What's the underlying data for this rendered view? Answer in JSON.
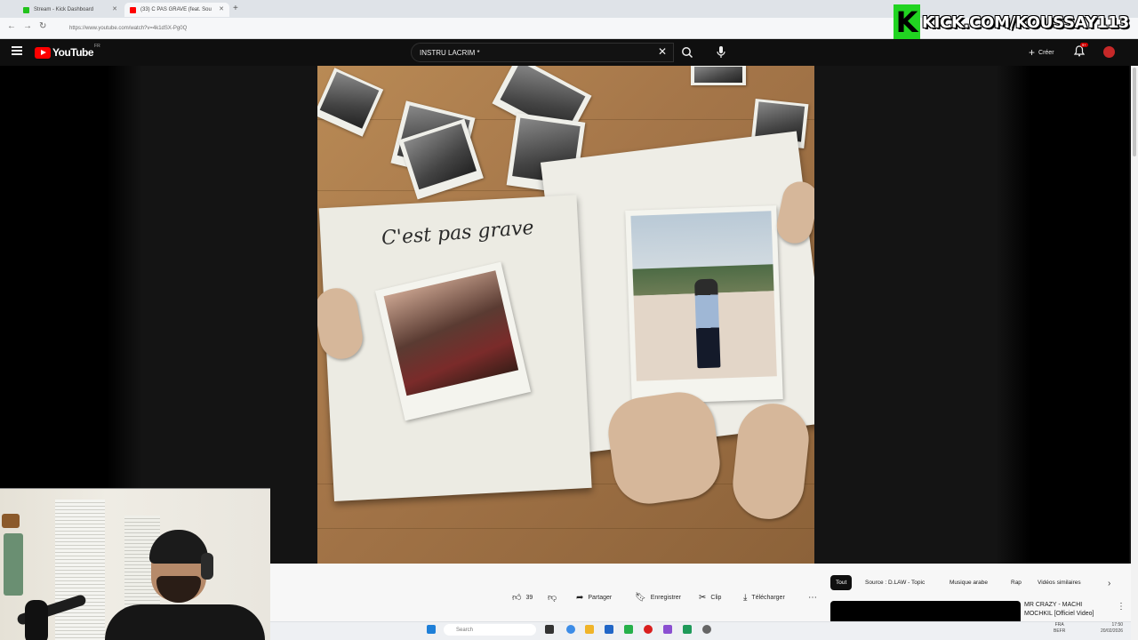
{
  "browser": {
    "tabs": [
      {
        "label": "Stream - Kick Dashboard",
        "favicon_color": "#21c21c"
      },
      {
        "label": "(33) C PAS GRAVE (feat. Sou",
        "favicon_color": "#ff0000"
      }
    ],
    "url": "https://www.youtube.com/watch?v=4k1dSX-Pg0Q"
  },
  "overlay": {
    "kick_logo": "K",
    "kick_text": "KICK.COM/KOUSSAY113",
    "accent": "#21d421"
  },
  "youtube": {
    "logo_word": "YouTube",
    "country_code": "FR",
    "search_value": "INSTRU LACRIM *",
    "create_label": "Créer",
    "notification_badge": "9+",
    "video": {
      "cover_text": "C'est pas grave"
    },
    "actions": {
      "like_count": "39",
      "share": "Partager",
      "save": "Enregistrer",
      "clip": "Clip",
      "download": "Télécharger"
    },
    "chips": [
      "Tout",
      "Source : D.LAW - Topic",
      "Musique arabe",
      "Rap",
      "Vidéos similaires"
    ],
    "next_video_title": "MR CRAZY - MACHI MOCHKIL [Officiel Video]"
  },
  "taskbar": {
    "search_placeholder": "Search",
    "tray_lang": "FRA",
    "tray_kb": "BEFR",
    "time": "17:50",
    "date": "20/02/2026"
  }
}
